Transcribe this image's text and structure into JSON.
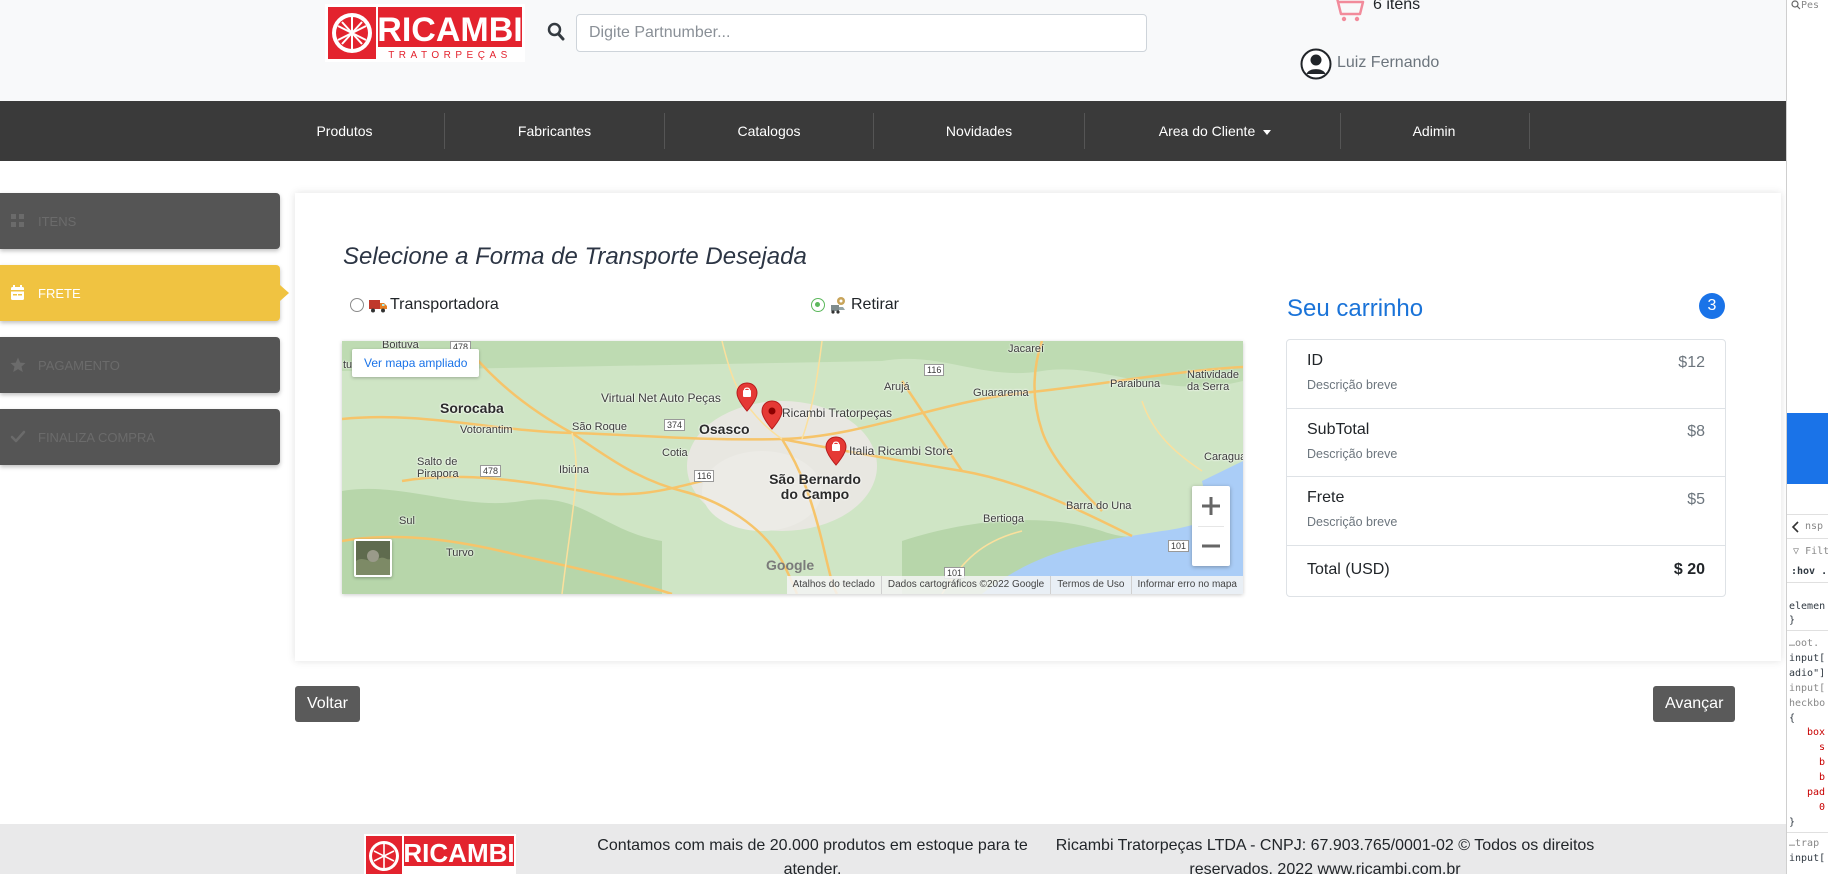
{
  "header": {
    "logo_text": "RICAMBI",
    "logo_subtext": "TRATORPEÇAS",
    "search": {
      "placeholder": "Digite Partnumber...",
      "value": ""
    },
    "cart_count": "6 itens",
    "user_name": "Luiz Fernando"
  },
  "nav": {
    "items": [
      {
        "label": "Produtos"
      },
      {
        "label": "Fabricantes"
      },
      {
        "label": "Catalogos"
      },
      {
        "label": "Novidades"
      },
      {
        "label": "Area do Cliente"
      },
      {
        "label": "Adimin"
      }
    ]
  },
  "steps": [
    {
      "label": "ITENS",
      "icon": "grid-icon",
      "active": false
    },
    {
      "label": "FRETE",
      "icon": "calendar-icon",
      "active": true
    },
    {
      "label": "PAGAMENTO",
      "icon": "star-icon",
      "active": false
    },
    {
      "label": "FINALIZA COMPRA",
      "icon": "check-icon",
      "active": false
    }
  ],
  "main": {
    "title": "Selecione a Forma de Transporte Desejada",
    "options": [
      {
        "label": "Transportadora",
        "icon": "truck-icon",
        "checked": false
      },
      {
        "label": "Retirar",
        "icon": "pickup-icon",
        "checked": true
      }
    ]
  },
  "map": {
    "enlarge_label": "Ver mapa ampliado",
    "places": {
      "boituva": "Boituva",
      "jacarei": "Jacareí",
      "sorocaba": "Sorocaba",
      "aruja": "Arujá",
      "guararema": "Guararema",
      "paraibuna": "Paraibuna",
      "natividade": "Natividade da Serra",
      "votorantim": "Votorantim",
      "sao_roque": "São Roque",
      "osasco": "Osasco",
      "cotia": "Cotia",
      "salto": "Salto de Pirapora",
      "ibiuna": "Ibiúna",
      "sbc": "São Bernardo do Campo",
      "caraguatatuba": "Caraguat",
      "bertioga": "Bertioga",
      "barra_do_una": "Barra do Una",
      "sul": "Sul",
      "turvo": "Turvo",
      "tu": "tu"
    },
    "road_numbers": [
      "478",
      "116",
      "374",
      "116",
      "478",
      "101",
      "101"
    ],
    "pois": [
      {
        "label": "Virtual Net Auto Peças"
      },
      {
        "label": "Ricambi Tratorpeças"
      },
      {
        "label": "Italia Ricambi Store"
      }
    ],
    "zoom_in": "+",
    "zoom_out": "−",
    "google_logo": "Google",
    "footer": {
      "shortcuts": "Atalhos do teclado",
      "data": "Dados cartográficos ©2022 Google",
      "terms": "Termos de Uso",
      "report": "Informar erro no mapa"
    }
  },
  "cart": {
    "title": "Seu carrinho",
    "badge": "3",
    "rows": [
      {
        "name": "ID",
        "desc": "Descrição breve",
        "price": "$12"
      },
      {
        "name": "SubTotal",
        "desc": "Descrição breve",
        "price": "$8"
      },
      {
        "name": "Frete",
        "desc": "Descrição breve",
        "price": "$5"
      }
    ],
    "total_label": "Total (USD)",
    "total_value": "$ 20"
  },
  "buttons": {
    "back": "Voltar",
    "next": "Avançar"
  },
  "footer": {
    "logo_text": "RICAMBI",
    "stock_text": "Contamos com mais de 20.000 produtos em estoque para te atender.",
    "legal_text": "Ricambi Tratorpeças LTDA - CNPJ: 67.903.765/0001-02 © Todos os direitos reservados. 2022 www.ricambi.com.br"
  },
  "devtools": {
    "search_stub": "Pes",
    "inspect_stub": "nsp",
    "filter_stub": "Filt",
    "hov_stub": ":hov .",
    "lines": [
      "elemen",
      "}",
      "…oot.",
      "input[",
      "adio\"]",
      "input[",
      "heckbo",
      "{",
      "box",
      "s",
      "b",
      "b",
      "pad",
      "0",
      "}",
      "…trap",
      "input["
    ]
  },
  "colors": {
    "nav_bg": "#3a3a3a",
    "step_active": "#f0c341",
    "step_inactive": "#555555",
    "cart_title": "#1a73d8",
    "badge": "#1a73e8",
    "logo_red": "#e3232e"
  }
}
